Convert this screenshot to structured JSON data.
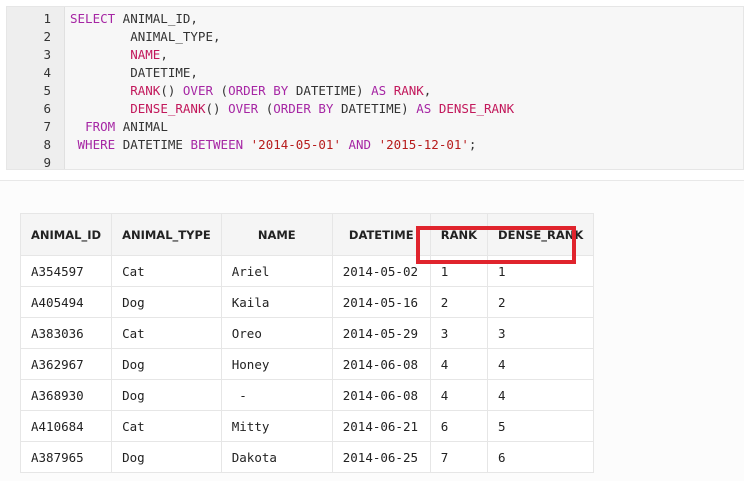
{
  "editor": {
    "lines": [
      {
        "n": "1",
        "parts": [
          [
            "kw",
            "SELECT"
          ],
          [
            "t",
            " ANIMAL_ID,"
          ]
        ]
      },
      {
        "n": "2",
        "parts": [
          [
            "t",
            "        ANIMAL_TYPE,"
          ]
        ]
      },
      {
        "n": "3",
        "parts": [
          [
            "t",
            "        "
          ],
          [
            "fn",
            "NAME"
          ],
          [
            "t",
            ","
          ]
        ]
      },
      {
        "n": "4",
        "parts": [
          [
            "t",
            "        DATETIME,"
          ]
        ]
      },
      {
        "n": "5",
        "parts": [
          [
            "t",
            "        "
          ],
          [
            "fn",
            "RANK"
          ],
          [
            "t",
            "() "
          ],
          [
            "kw",
            "OVER"
          ],
          [
            "t",
            " ("
          ],
          [
            "kw",
            "ORDER BY"
          ],
          [
            "t",
            " DATETIME) "
          ],
          [
            "kw",
            "AS"
          ],
          [
            "t",
            " "
          ],
          [
            "fn",
            "RANK"
          ],
          [
            "t",
            ","
          ]
        ]
      },
      {
        "n": "6",
        "parts": [
          [
            "t",
            "        "
          ],
          [
            "fn",
            "DENSE_RANK"
          ],
          [
            "t",
            "() "
          ],
          [
            "kw",
            "OVER"
          ],
          [
            "t",
            " ("
          ],
          [
            "kw",
            "ORDER BY"
          ],
          [
            "t",
            " DATETIME) "
          ],
          [
            "kw",
            "AS"
          ],
          [
            "t",
            " "
          ],
          [
            "fn",
            "DENSE_RANK"
          ]
        ]
      },
      {
        "n": "7",
        "parts": [
          [
            "t",
            "  "
          ],
          [
            "kw",
            "FROM"
          ],
          [
            "t",
            " ANIMAL"
          ]
        ]
      },
      {
        "n": "8",
        "parts": [
          [
            "t",
            " "
          ],
          [
            "kw",
            "WHERE"
          ],
          [
            "t",
            " DATETIME "
          ],
          [
            "kw",
            "BETWEEN"
          ],
          [
            "t",
            " "
          ],
          [
            "str",
            "'2014-05-01'"
          ],
          [
            "t",
            " "
          ],
          [
            "kw",
            "AND"
          ],
          [
            "t",
            " "
          ],
          [
            "str",
            "'2015-12-01'"
          ],
          [
            "t",
            ";"
          ]
        ]
      },
      {
        "n": "9",
        "parts": []
      }
    ]
  },
  "results": {
    "headers": [
      "ANIMAL_ID",
      "ANIMAL_TYPE",
      "NAME",
      "DATETIME",
      "RANK",
      "DENSE_RANK"
    ],
    "rows": [
      [
        "A354597",
        "Cat",
        "Ariel",
        "2014-05-02",
        "1",
        "1"
      ],
      [
        "A405494",
        "Dog",
        "Kaila",
        "2014-05-16",
        "2",
        "2"
      ],
      [
        "A383036",
        "Cat",
        "Oreo",
        "2014-05-29",
        "3",
        "3"
      ],
      [
        "A362967",
        "Dog",
        "Honey",
        "2014-06-08",
        "4",
        "4"
      ],
      [
        "A368930",
        "Dog",
        " -",
        "2014-06-08",
        "4",
        "4"
      ],
      [
        "A410684",
        "Cat",
        "Mitty",
        "2014-06-21",
        "6",
        "5"
      ],
      [
        "A387965",
        "Dog",
        "Dakota",
        "2014-06-25",
        "7",
        "6"
      ]
    ],
    "highlight_color": "#e0242d"
  }
}
